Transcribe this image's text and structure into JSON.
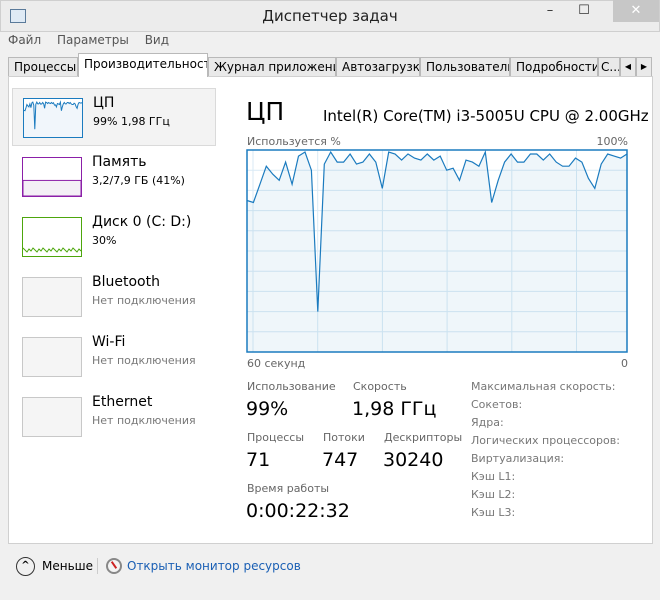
{
  "window": {
    "title": "Диспетчер задач",
    "min": "–",
    "max": "☐",
    "close": "✕"
  },
  "menu": [
    "Файл",
    "Параметры",
    "Вид"
  ],
  "tabs": [
    "Процессы",
    "Производительность",
    "Журнал приложений",
    "Автозагрузка",
    "Пользователи",
    "Подробности",
    "Службы"
  ],
  "tabs_visible": [
    "Процессы",
    "Производительность",
    "Журнал приложений",
    "Автозагрузка",
    "Пользователи",
    "Подробности",
    "С..."
  ],
  "active_tab": "Производительность",
  "sidebar": [
    {
      "name": "ЦП",
      "sub": "99%  1,98 ГГц",
      "color": "#1b7bbf"
    },
    {
      "name": "Память",
      "sub": "3,2/7,9 ГБ (41%)",
      "color": "#8b1fa8",
      "fill": 0.41
    },
    {
      "name": "Диск 0 (C: D:)",
      "sub": "30%",
      "color": "#4da60c"
    },
    {
      "name": "Bluetooth",
      "sub": "Нет подключения"
    },
    {
      "name": "Wi-Fi",
      "sub": "Нет подключения"
    },
    {
      "name": "Ethernet",
      "sub": "Нет подключения"
    }
  ],
  "main": {
    "title": "ЦП",
    "cpu_name": "Intel(R) Core(TM) i3-5005U CPU @ 2.00GHz",
    "chart_label": "Используется %",
    "chart_max": "100%",
    "chart_left": "60 секунд",
    "chart_right": "0",
    "stats": {
      "usage_label": "Использование",
      "usage": "99%",
      "speed_label": "Скорость",
      "speed": "1,98 ГГц",
      "proc_label": "Процессы",
      "proc": "71",
      "threads_label": "Потоки",
      "threads": "747",
      "handles_label": "Дескрипторы",
      "handles": "30240",
      "uptime_label": "Время работы",
      "uptime": "0:00:22:32"
    },
    "right_labels": [
      "Максимальная скорость:",
      "Сокетов:",
      "Ядра:",
      "Логических процессоров:",
      "Виртуализация:",
      "Кэш L1:",
      "Кэш L2:",
      "Кэш L3:"
    ]
  },
  "footer": {
    "less": "Меньше",
    "monitor": "Открыть монитор ресурсов"
  },
  "chart_data": {
    "type": "area",
    "xlabel": "60 секунд",
    "ylim": [
      0,
      100
    ],
    "xlim": [
      60,
      0
    ],
    "color": "#1b7bbf",
    "grid": true,
    "values": [
      75,
      74,
      83,
      92,
      88,
      85,
      94,
      83,
      97,
      99,
      90,
      20,
      93,
      99,
      94,
      94,
      98,
      93,
      94,
      98,
      94,
      81,
      99,
      98,
      95,
      98,
      96,
      95,
      98,
      95,
      97,
      90,
      91,
      85,
      95,
      94,
      92,
      99,
      74,
      85,
      94,
      98,
      94,
      94,
      98,
      98,
      95,
      98,
      94,
      92,
      92,
      96,
      94,
      86,
      81,
      93,
      98,
      97,
      96,
      98
    ]
  }
}
